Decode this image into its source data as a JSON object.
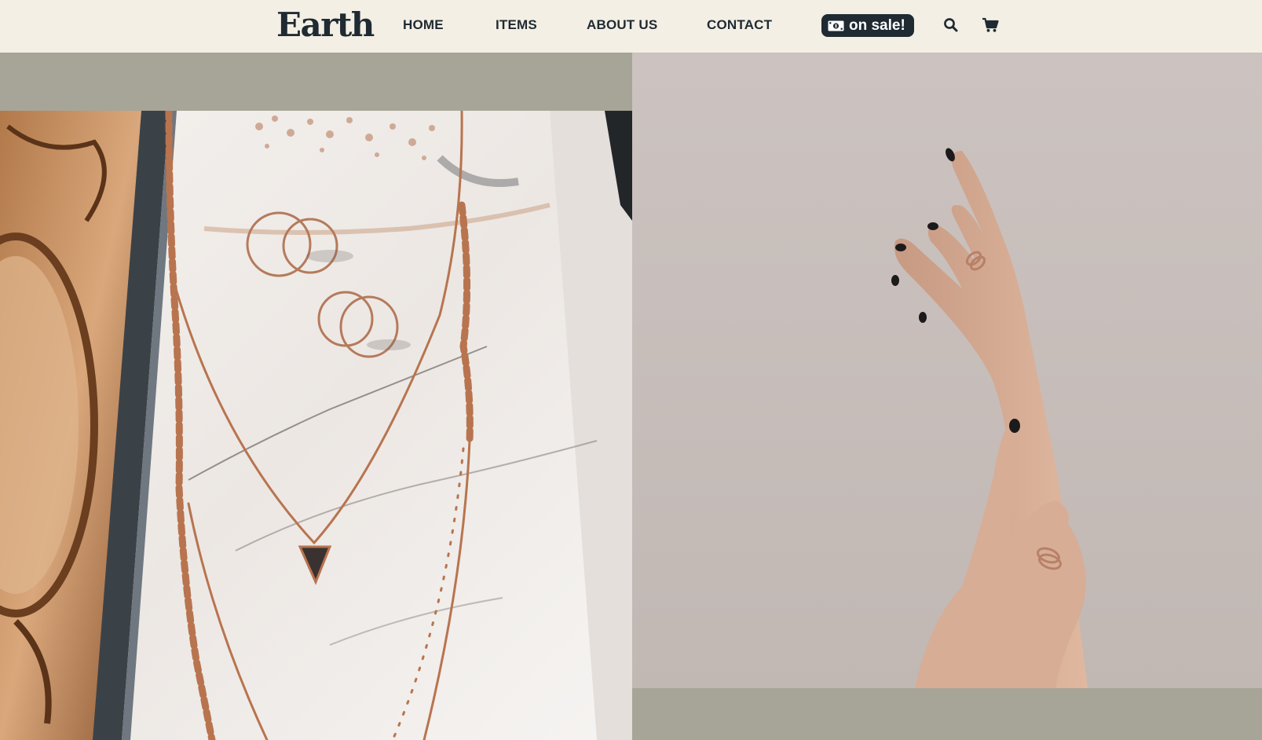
{
  "brand": {
    "logo_text": "Earth"
  },
  "nav": {
    "items": [
      {
        "label": "HOME"
      },
      {
        "label": "ITEMS"
      },
      {
        "label": "ABOUT US"
      },
      {
        "label": "CONTACT"
      }
    ],
    "sale_badge": {
      "label": "on sale!",
      "icon": "money-bill-icon"
    },
    "icons": [
      "search-icon",
      "cart-icon"
    ]
  },
  "hero": {
    "left_image": "jewelry-on-marble-photo",
    "right_image": "hands-with-rings-photo"
  },
  "colors": {
    "header_bg": "#f3efe4",
    "text_dark": "#1f2a32",
    "sage_bg": "#a7a597",
    "badge_bg": "#1f2a32"
  }
}
